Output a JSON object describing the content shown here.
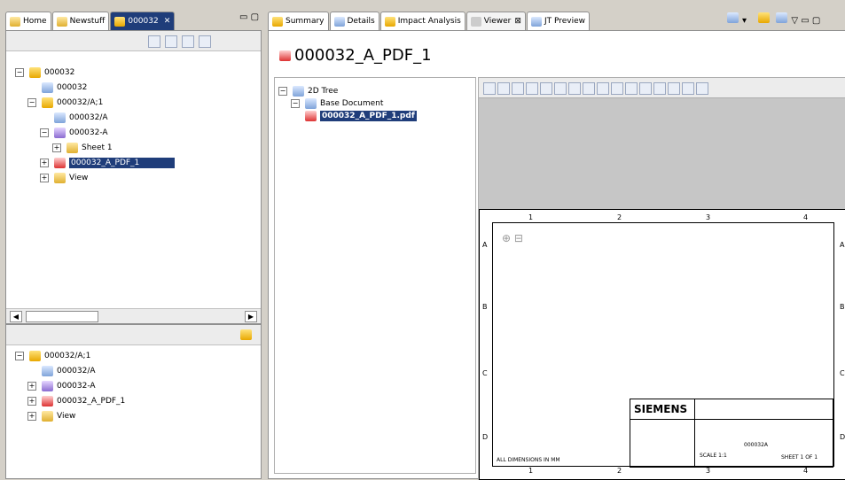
{
  "left_tabs": [
    {
      "label": "Home",
      "icon": "home-icon"
    },
    {
      "label": "Newstuff",
      "icon": "folder-icon"
    },
    {
      "label": "000032",
      "icon": "item-icon",
      "active": true
    }
  ],
  "right_tabs": [
    {
      "label": "Summary",
      "icon": "summary-icon"
    },
    {
      "label": "Details",
      "icon": "details-icon"
    },
    {
      "label": "Impact Analysis",
      "icon": "impact-icon"
    },
    {
      "label": "Viewer",
      "icon": "viewer-icon",
      "active": true
    },
    {
      "label": "JT Preview",
      "icon": "jt-preview-icon"
    }
  ],
  "top_tree": [
    {
      "label": "000032",
      "level": 0,
      "exp": "−",
      "icon": "item-icon"
    },
    {
      "label": "000032",
      "level": 1,
      "exp": "",
      "icon": "text-icon"
    },
    {
      "label": "000032/A;1",
      "level": 1,
      "exp": "−",
      "icon": "revision-icon"
    },
    {
      "label": "000032/A",
      "level": 2,
      "exp": "",
      "icon": "text-icon"
    },
    {
      "label": "000032-A",
      "level": 2,
      "exp": "−",
      "icon": "dataset-icon"
    },
    {
      "label": "Sheet 1",
      "level": 3,
      "exp": "+",
      "icon": "sheet-icon"
    },
    {
      "label": "000032_A_PDF_1",
      "level": 2,
      "exp": "+",
      "icon": "pdf-icon",
      "selected": true
    },
    {
      "label": "View",
      "level": 2,
      "exp": "+",
      "icon": "view-icon"
    }
  ],
  "bottom_tree": [
    {
      "label": "000032/A;1",
      "level": 0,
      "exp": "−",
      "icon": "revision-icon"
    },
    {
      "label": "000032/A",
      "level": 1,
      "exp": "",
      "icon": "text-icon"
    },
    {
      "label": "000032-A",
      "level": 1,
      "exp": "+",
      "icon": "dataset-icon"
    },
    {
      "label": "000032_A_PDF_1",
      "level": 1,
      "exp": "+",
      "icon": "pdf-icon"
    },
    {
      "label": "View",
      "level": 1,
      "exp": "+",
      "icon": "view-icon"
    }
  ],
  "viewer_title": "000032_A_PDF_1",
  "viewer_tree": {
    "root": "2D Tree",
    "child": "Base Document",
    "file": "000032_A_PDF_1.pdf"
  },
  "drawing": {
    "cols": [
      "1",
      "2",
      "3",
      "4"
    ],
    "rows": [
      "A",
      "B",
      "C",
      "D"
    ],
    "brand": "SIEMENS",
    "dims_note": "ALL DIMENSIONS IN MM",
    "sheet_label": "SHEET 1 OF 1",
    "scale_label": "SCALE 1:1",
    "drawing_no": "000032A"
  }
}
